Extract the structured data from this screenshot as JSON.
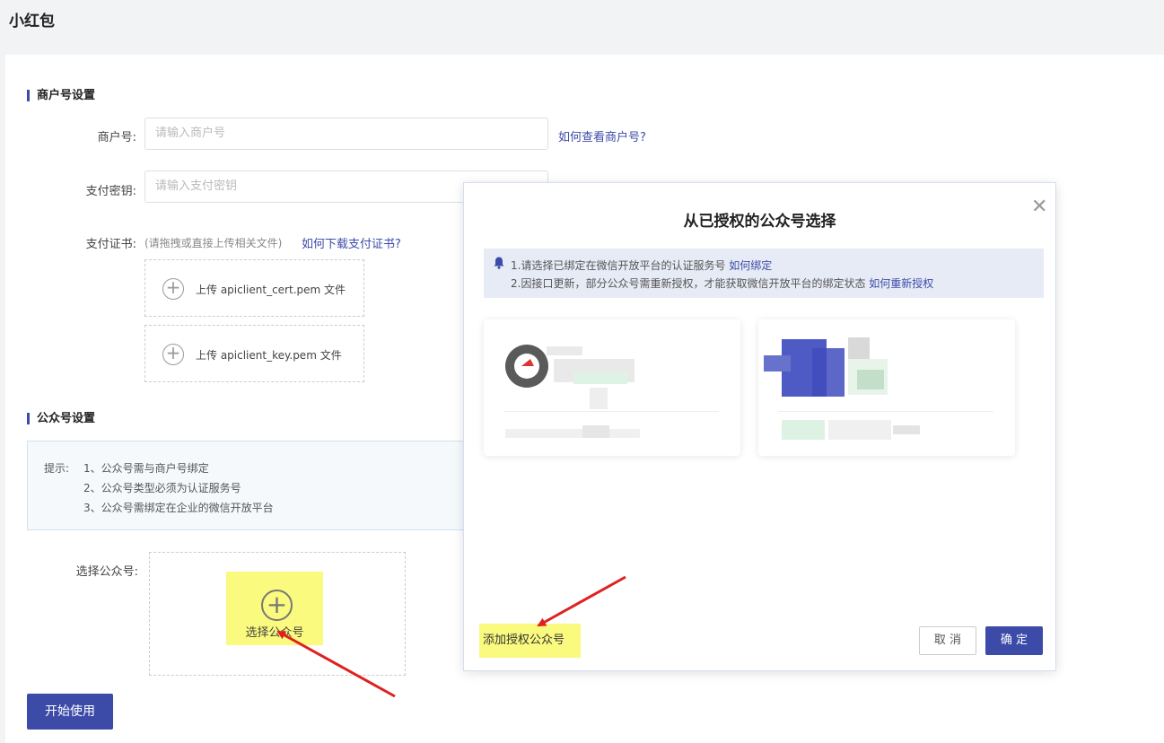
{
  "page": {
    "title": "小红包"
  },
  "merchant": {
    "section_title": "商户号设置",
    "merchant_no_label": "商户号:",
    "merchant_no_placeholder": "请输入商户号",
    "merchant_no_help": "如何查看商户号?",
    "pay_key_label": "支付密钥:",
    "pay_key_placeholder": "请输入支付密钥",
    "cert_label": "支付证书:",
    "cert_hint": "(请拖拽或直接上传相关文件)",
    "cert_help": "如何下载支付证书?",
    "upload_cert": "上传 apiclient_cert.pem 文件",
    "upload_key": "上传 apiclient_key.pem 文件"
  },
  "official": {
    "section_title": "公众号设置",
    "tip_prefix": "提示:",
    "tips": [
      "1、公众号需与商户号绑定",
      "2、公众号类型必须为认证服务号",
      "3、公众号需绑定在企业的微信开放平台"
    ],
    "select_label": "选择公众号:",
    "select_button": "选择公众号"
  },
  "start_button": "开始使用",
  "dialog": {
    "title": "从已授权的公众号选择",
    "notice_line1": "1.请选择已绑定在微信开放平台的认证服务号",
    "notice_link1": "如何绑定",
    "notice_line2": "2.因接口更新，部分公众号需重新授权，才能获取微信开放平台的绑定状态",
    "notice_link2": "如何重新授权",
    "add_auth": "添加授权公众号",
    "cancel": "取 消",
    "confirm": "确 定"
  },
  "icons": {
    "close": "close-icon",
    "bell": "bell-icon",
    "plus": "plus-circle-icon"
  },
  "colors": {
    "primary": "#3c4ba8",
    "highlight": "#fafa7e",
    "arrow": "#e02020"
  }
}
